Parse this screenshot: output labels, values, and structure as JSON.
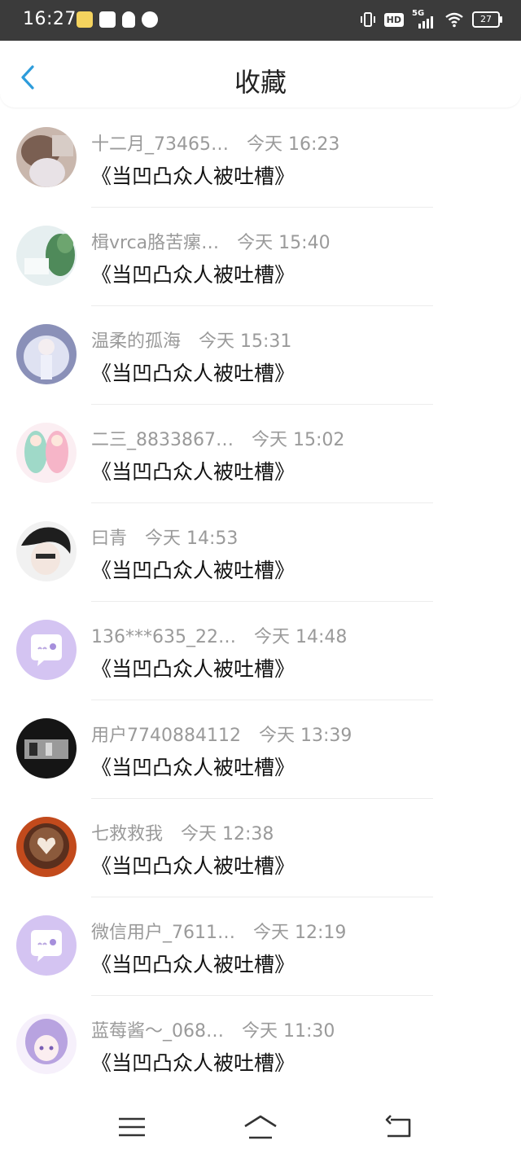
{
  "status_bar": {
    "time": "16:27",
    "network": "5G",
    "hd": "HD",
    "battery": "27"
  },
  "header": {
    "title": "收藏"
  },
  "items": [
    {
      "name": "十二月_73465…",
      "time": "今天  16:23",
      "message": "《当凹凸众人被吐槽》"
    },
    {
      "name": "楫vrca胳苦瘰…",
      "time": "今天  15:40",
      "message": "《当凹凸众人被吐槽》"
    },
    {
      "name": "温柔的孤海",
      "time": "今天  15:31",
      "message": "《当凹凸众人被吐槽》"
    },
    {
      "name": "二三_8833867…",
      "time": "今天  15:02",
      "message": "《当凹凸众人被吐槽》"
    },
    {
      "name": "曰青",
      "time": "今天  14:53",
      "message": "《当凹凸众人被吐槽》"
    },
    {
      "name": "136***635_22…",
      "time": "今天  14:48",
      "message": "《当凹凸众人被吐槽》"
    },
    {
      "name": "用户7740884112",
      "time": "今天  13:39",
      "message": "《当凹凸众人被吐槽》"
    },
    {
      "name": "七救救我",
      "time": "今天  12:38",
      "message": "《当凹凸众人被吐槽》"
    },
    {
      "name": "微信用户_7611…",
      "time": "今天  12:19",
      "message": "《当凹凸众人被吐槽》"
    },
    {
      "name": "蓝莓酱～_068…",
      "time": "今天  11:30",
      "message": "《当凹凸众人被吐槽》"
    }
  ],
  "colors": {
    "accent_back": "#2d9cdb",
    "status_bar_bg": "#3b3b3b",
    "meta_text": "#9a9a9a",
    "default_avatar": "#d4c4f2"
  },
  "icons": {
    "back": "chevron-left-icon",
    "default_avatar": "chat-bubble-icon",
    "nav_menu": "menu-icon",
    "nav_home": "home-icon",
    "nav_back": "return-icon"
  }
}
